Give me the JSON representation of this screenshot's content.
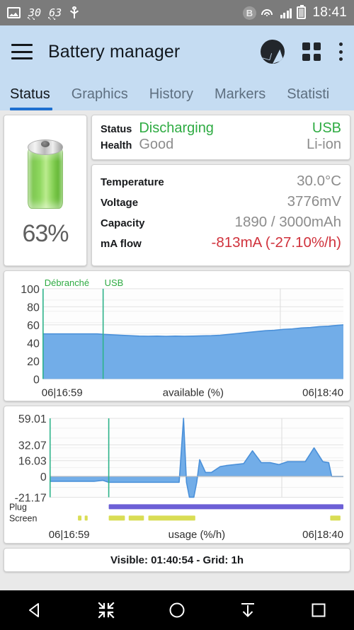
{
  "statusbar": {
    "left_icons": [
      "gallery-icon",
      "usb-icon"
    ],
    "sensor_1": "30",
    "sensor_2": "63",
    "right_icons": [
      "bluetooth-icon",
      "wifi-icon",
      "signal-icon",
      "battery-icon"
    ],
    "clock": "18:41"
  },
  "appbar": {
    "title": "Battery manager",
    "menu_icon": "hamburger-icon",
    "actions": [
      "pie-chart-icon",
      "grid-icon",
      "overflow-menu-icon"
    ]
  },
  "tabs": [
    {
      "label": "Status",
      "active": true
    },
    {
      "label": "Graphics",
      "active": false
    },
    {
      "label": "History",
      "active": false
    },
    {
      "label": "Markers",
      "active": false
    },
    {
      "label": "Statisti",
      "active": false
    }
  ],
  "battery": {
    "percent": "63%",
    "icon": "battery-cell-icon"
  },
  "status_card": {
    "status_label": "Status",
    "status_value": "Discharging",
    "status_right": "USB",
    "health_label": "Health",
    "health_value": "Good",
    "health_right": "Li-ion"
  },
  "details_card": {
    "rows": [
      {
        "label": "Temperature",
        "value": "30.0°C",
        "color": "grey"
      },
      {
        "label": "Voltage",
        "value": "3776mV",
        "color": "grey"
      },
      {
        "label": "Capacity",
        "value": "1890 / 3000mAh",
        "color": "grey"
      },
      {
        "label": "mA flow",
        "value": "-813mA (-27.10%/h)",
        "color": "red"
      }
    ]
  },
  "colors": {
    "accent": "#1d6fd0",
    "appbar": "#c5dcf2",
    "chart_fill": "#72ade8",
    "chart_line": "#4a90d9",
    "marker": "#2db38a",
    "marker_text": "#2eab42",
    "plug_bar": "#6c5fd6",
    "screen_bar": "#d9dd54",
    "positive": "#2eab42",
    "negative": "#d0323c"
  },
  "footer": {
    "text": "Visible: 01:40:54 - Grid: 1h"
  },
  "navbar": {
    "buttons": [
      "back-icon",
      "collapse-icon",
      "home-icon",
      "download-icon",
      "recents-icon"
    ]
  },
  "chart_data": [
    {
      "type": "area",
      "title": "available (%)",
      "xlabel": "available (%)",
      "ylabel": "",
      "x_start": "06|16:59",
      "x_end": "06|18:40",
      "ylim": [
        0,
        100
      ],
      "yticks": [
        0,
        20,
        40,
        60,
        80,
        100
      ],
      "grid": true,
      "markers": [
        {
          "label": "Débranché",
          "x_frac": 0.0
        },
        {
          "label": "USB",
          "x_frac": 0.2
        }
      ],
      "x": [
        0,
        0.03,
        0.06,
        0.09,
        0.12,
        0.15,
        0.18,
        0.2,
        0.23,
        0.26,
        0.29,
        0.32,
        0.35,
        0.38,
        0.41,
        0.44,
        0.47,
        0.5,
        0.53,
        0.56,
        0.59,
        0.62,
        0.65,
        0.68,
        0.71,
        0.74,
        0.77,
        0.8,
        0.83,
        0.86,
        0.89,
        0.92,
        0.95,
        0.98,
        1.0
      ],
      "values": [
        50,
        50,
        50,
        50,
        50,
        50,
        50,
        49.5,
        49,
        48.5,
        48,
        47.5,
        47.3,
        47.5,
        47.2,
        47.5,
        47.3,
        47.5,
        47.8,
        48,
        48.5,
        49.5,
        50.5,
        51.5,
        52.5,
        53.5,
        54,
        55,
        55.5,
        56.5,
        57,
        58,
        58.5,
        59.5,
        60
      ]
    },
    {
      "type": "area",
      "title": "usage (%/h)",
      "xlabel": "usage (%/h)",
      "ylabel": "",
      "x_start": "06|16:59",
      "x_end": "06|18:40",
      "ylim": [
        -21.17,
        59.01
      ],
      "yticks": [
        -21.17,
        0,
        16.03,
        32.07,
        59.01
      ],
      "ytick_labels": [
        "-21.17",
        "0",
        "16.03",
        "32.07",
        "59.01"
      ],
      "grid": true,
      "baseline": 0,
      "markers": [
        {
          "label": "",
          "x_frac": 0.0
        },
        {
          "label": "",
          "x_frac": 0.2
        }
      ],
      "x": [
        0,
        0.05,
        0.1,
        0.15,
        0.18,
        0.2,
        0.25,
        0.3,
        0.35,
        0.4,
        0.44,
        0.455,
        0.465,
        0.475,
        0.49,
        0.5,
        0.51,
        0.53,
        0.55,
        0.58,
        0.6,
        0.63,
        0.66,
        0.69,
        0.72,
        0.75,
        0.78,
        0.81,
        0.84,
        0.87,
        0.9,
        0.93,
        0.95,
        0.96,
        1.0
      ],
      "values": [
        -5,
        -5,
        -5,
        -5,
        -4,
        -6,
        -6,
        -6,
        -6,
        -6,
        -6,
        59.01,
        -6,
        -21.17,
        -21.17,
        -6,
        17,
        4,
        4,
        10,
        11,
        12,
        13,
        26,
        14,
        14,
        12,
        15,
        15,
        15,
        29,
        15,
        14,
        0,
        0
      ],
      "plug_track": {
        "label": "Plug",
        "color": "#6c5fd6",
        "segments": [
          {
            "start": 0.2,
            "end": 1.0
          }
        ]
      },
      "screen_track": {
        "label": "Screen",
        "color": "#d9dd54",
        "segments": [
          {
            "start": 0.095,
            "end": 0.107
          },
          {
            "start": 0.118,
            "end": 0.128
          },
          {
            "start": 0.2,
            "end": 0.255
          },
          {
            "start": 0.268,
            "end": 0.32
          },
          {
            "start": 0.335,
            "end": 0.495
          },
          {
            "start": 0.955,
            "end": 0.99
          }
        ]
      }
    }
  ]
}
